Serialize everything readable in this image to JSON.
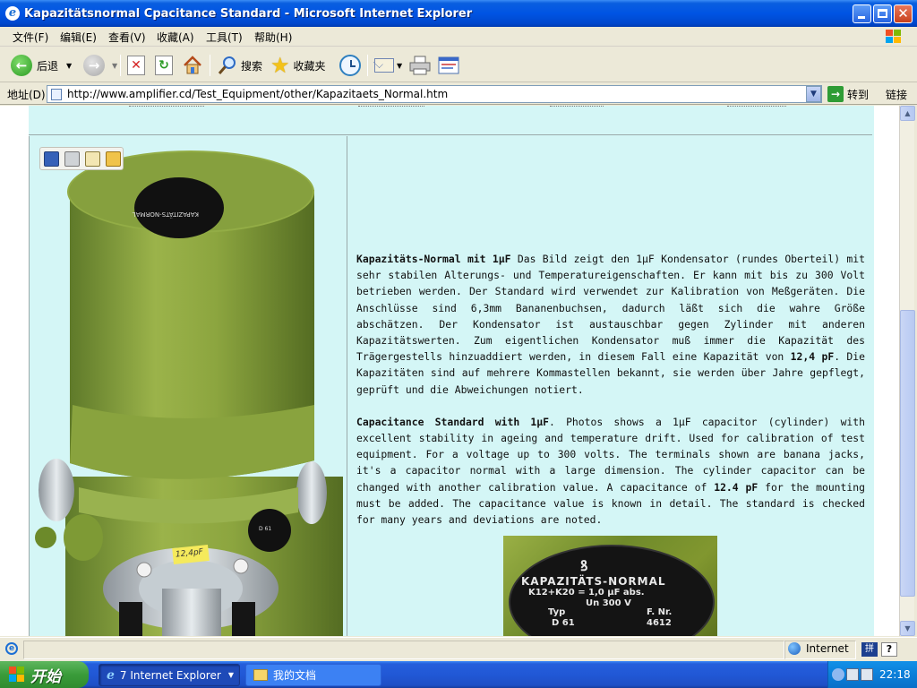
{
  "window": {
    "title": "Kapazitätsnormal Cpacitance Standard - Microsoft Internet Explorer"
  },
  "menu": [
    "文件(F)",
    "编辑(E)",
    "查看(V)",
    "收藏(A)",
    "工具(T)",
    "帮助(H)"
  ],
  "toolbar": {
    "back": "后退",
    "search": "搜索",
    "favorites": "收藏夹"
  },
  "address": {
    "label": "地址(D)",
    "url": "http://www.amplifier.cd/Test_Equipment/other/Kapazitaets_Normal.htm",
    "go": "转到",
    "links": "链接"
  },
  "page": {
    "para1": {
      "bold1": "Kapazitäts-Normal mit 1µF",
      "text1": " Das Bild zeigt den 1µF Kondensator (rundes Oberteil) mit sehr stabilen Alterungs- und Temperatureigenschaften. Er kann mit bis zu 300 Volt betrieben werden. Der Standard wird verwendet zur Kalibration von Meßgeräten. Die Anschlüsse sind 6,3mm Bananenbuchsen, dadurch läßt sich die wahre Größe abschätzen. Der Kondensator ist austauschbar gegen Zylinder mit anderen Kapazitätswerten. Zum eigentlichen Kondensator muß immer die Kapazität des Trägergestells hinzuaddiert werden, in diesem Fall eine Kapazität von ",
      "bold2": "12,4 pF",
      "text2": ". Die Kapazitäten sind auf mehrere Kommastellen bekannt, sie werden über Jahre gepflegt, geprüft und die Abweichungen notiert."
    },
    "para2": {
      "bold1": "Capacitance Standard with 1µF",
      "text1": ". Photos shows a 1µF capacitor (cylinder) with excellent stability in ageing and temperature drift. Used for calibration of test equipment. For a voltage up to 300 volts. The terminals shown are banana jacks, it's a capacitor normal with a large dimension. The cylinder capacitor can be changed with another calibration value. A capacitance of ",
      "bold2": "12.4 pF",
      "text2": " for the mounting must be added. The capacitance value is known in detail. The standard is checked for many years and deviations are noted."
    },
    "photo_tag": "12,4pF",
    "label": {
      "line1": "KAPAZITÄTS-NORMAL",
      "line2": "K12+K20 = 1,0 µF abs.",
      "line3": "Un 300 V",
      "typ": "Typ",
      "typ_val": "D 61",
      "fnr": "F. Nr.",
      "fnr_val": "4612"
    }
  },
  "status": {
    "zone": "Internet"
  },
  "taskbar": {
    "start": "开始",
    "task1": "7 Internet Explorer",
    "task2": "我的文档",
    "time": "22:18"
  }
}
